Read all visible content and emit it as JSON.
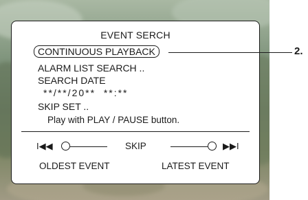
{
  "menu": {
    "title": "EVENT SERCH",
    "items": [
      {
        "label": "CONTINUOUS PLAYBACK",
        "selected": true
      },
      {
        "label": "ALARM LIST SEARCH .."
      },
      {
        "label": "SEARCH DATE"
      },
      {
        "label": "**/**/20**  **:**"
      },
      {
        "label": "SKIP SET .."
      }
    ],
    "hint": "Play with PLAY / PAUSE button."
  },
  "callout": {
    "label": "2."
  },
  "skip_bar": {
    "label": "SKIP",
    "rewind_glyph": "I◀◀",
    "forward_glyph": "▶▶I",
    "oldest_label": "OLDEST EVENT",
    "latest_label": "LATEST EVENT"
  },
  "icons": {
    "rewind": "skip-to-oldest-icon",
    "forward": "skip-to-latest-icon"
  },
  "colors": {
    "panel_bg": "#ffffff",
    "ink": "#1a1a1a"
  }
}
